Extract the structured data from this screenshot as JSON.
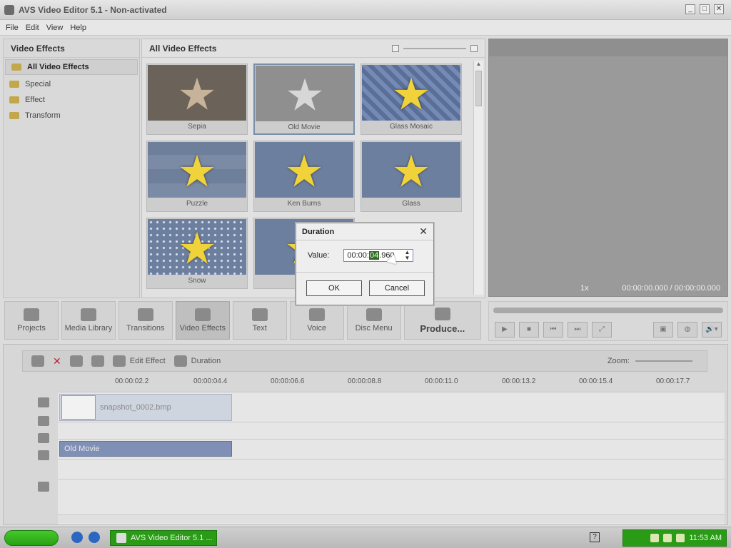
{
  "window": {
    "title": "AVS Video Editor 5.1 - Non-activated",
    "controls": {
      "minimize": "_",
      "maximize": "□",
      "close": "✕"
    }
  },
  "menu": [
    "File",
    "Edit",
    "View",
    "Help"
  ],
  "left_panel": {
    "header": "Video Effects",
    "items": [
      {
        "label": "All Video Effects",
        "selected": true
      },
      {
        "label": "Special",
        "selected": false
      },
      {
        "label": "Effect",
        "selected": false
      },
      {
        "label": "Transform",
        "selected": false
      }
    ]
  },
  "gallery": {
    "header": "All Video Effects",
    "cards": [
      {
        "label": "Sepia",
        "style": "sepia",
        "selected": false
      },
      {
        "label": "Old Movie",
        "style": "old",
        "selected": true
      },
      {
        "label": "Glass Mosaic",
        "style": "mosaic",
        "selected": false
      },
      {
        "label": "Puzzle",
        "style": "puzzle",
        "selected": false
      },
      {
        "label": "Ken Burns",
        "style": "ken",
        "selected": false
      },
      {
        "label": "Glass",
        "style": "glass",
        "selected": false
      },
      {
        "label": "Snow",
        "style": "snow",
        "selected": false
      },
      {
        "label": "Wa",
        "style": "wave",
        "selected": false
      }
    ]
  },
  "preview": {
    "speed": "1x",
    "time": "00:00:00.000 / 00:00:00.000"
  },
  "toolbar": {
    "buttons": [
      {
        "label": "Projects",
        "active": false
      },
      {
        "label": "Media Library",
        "active": false
      },
      {
        "label": "Transitions",
        "active": false
      },
      {
        "label": "Video Effects",
        "active": true
      },
      {
        "label": "Text",
        "active": false
      },
      {
        "label": "Voice",
        "active": false
      },
      {
        "label": "Disc Menu",
        "active": false
      },
      {
        "label": "Produce...",
        "active": false
      }
    ]
  },
  "playback": {
    "buttons": [
      "▶",
      "■",
      "⏮",
      "⏭",
      "⤢"
    ],
    "right_buttons": [
      "▣",
      "◍",
      "🔊▾"
    ]
  },
  "timeline": {
    "toolbar": {
      "delete_label": "✕",
      "edit_effect_label": "Edit Effect",
      "duration_label": "Duration",
      "zoom_label": "Zoom:"
    },
    "ruler": [
      "00:00:02.2",
      "00:00:04.4",
      "00:00:06.6",
      "00:00:08.8",
      "00:00:11.0",
      "00:00:13.2",
      "00:00:15.4",
      "00:00:17.7"
    ],
    "video_clip": "snapshot_0002.bmp",
    "effect_clip": "Old Movie"
  },
  "dialog": {
    "title": "Duration",
    "close": "✕",
    "value_label": "Value:",
    "value_pre": "00:00:",
    "value_sel": "04",
    "value_post": ".960",
    "ok": "OK",
    "cancel": "Cancel"
  },
  "taskbar": {
    "task_label": "AVS Video Editor 5.1 ...",
    "help": "?",
    "clock": "11:53 AM"
  }
}
